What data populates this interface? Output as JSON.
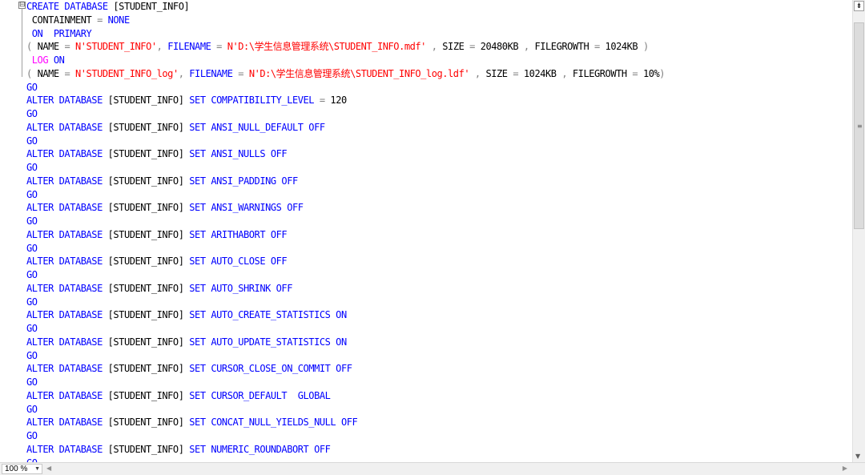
{
  "editor": {
    "lines": [
      [
        [
          "kw",
          "CREATE DATABASE"
        ],
        [
          "pl",
          " [STUDENT_INFO]"
        ]
      ],
      [
        [
          "pl",
          " CONTAINMENT"
        ],
        [
          "op",
          " = "
        ],
        [
          "kw",
          "NONE"
        ]
      ],
      [
        [
          "kw",
          " ON  PRIMARY"
        ]
      ],
      [
        [
          "op",
          "( "
        ],
        [
          "pl",
          "NAME"
        ],
        [
          "op",
          " = "
        ],
        [
          "st",
          "N'STUDENT_INFO'"
        ],
        [
          "op",
          ", "
        ],
        [
          "kw",
          "FILENAME"
        ],
        [
          "op",
          " = "
        ],
        [
          "st",
          "N'D:\\学生信息管理系统\\STUDENT_INFO.mdf'"
        ],
        [
          "op",
          " , "
        ],
        [
          "pl",
          "SIZE"
        ],
        [
          "op",
          " = "
        ],
        [
          "pl",
          "20480KB"
        ],
        [
          "op",
          " , "
        ],
        [
          "pl",
          "FILEGROWTH"
        ],
        [
          "op",
          " = "
        ],
        [
          "pl",
          "1024KB"
        ],
        [
          "op",
          " )"
        ]
      ],
      [
        [
          "lg",
          " LOG"
        ],
        [
          "kw",
          " ON"
        ]
      ],
      [
        [
          "op",
          "( "
        ],
        [
          "pl",
          "NAME"
        ],
        [
          "op",
          " = "
        ],
        [
          "st",
          "N'STUDENT_INFO_log'"
        ],
        [
          "op",
          ", "
        ],
        [
          "kw",
          "FILENAME"
        ],
        [
          "op",
          " = "
        ],
        [
          "st",
          "N'D:\\学生信息管理系统\\STUDENT_INFO_log.ldf'"
        ],
        [
          "op",
          " , "
        ],
        [
          "pl",
          "SIZE"
        ],
        [
          "op",
          " = "
        ],
        [
          "pl",
          "1024KB"
        ],
        [
          "op",
          " , "
        ],
        [
          "pl",
          "FILEGROWTH"
        ],
        [
          "op",
          " = "
        ],
        [
          "pl",
          "10%"
        ],
        [
          "op",
          ")"
        ]
      ],
      [
        [
          "kw",
          "GO"
        ]
      ],
      [
        [
          "kw",
          "ALTER DATABASE"
        ],
        [
          "pl",
          " [STUDENT_INFO] "
        ],
        [
          "kw",
          "SET COMPATIBILITY_LEVEL"
        ],
        [
          "op",
          " = "
        ],
        [
          "pl",
          "120"
        ]
      ],
      [
        [
          "kw",
          "GO"
        ]
      ],
      [
        [
          "kw",
          "ALTER DATABASE"
        ],
        [
          "pl",
          " [STUDENT_INFO] "
        ],
        [
          "kw",
          "SET ANSI_NULL_DEFAULT OFF"
        ]
      ],
      [
        [
          "kw",
          "GO"
        ]
      ],
      [
        [
          "kw",
          "ALTER DATABASE"
        ],
        [
          "pl",
          " [STUDENT_INFO] "
        ],
        [
          "kw",
          "SET ANSI_NULLS OFF"
        ]
      ],
      [
        [
          "kw",
          "GO"
        ]
      ],
      [
        [
          "kw",
          "ALTER DATABASE"
        ],
        [
          "pl",
          " [STUDENT_INFO] "
        ],
        [
          "kw",
          "SET ANSI_PADDING OFF"
        ]
      ],
      [
        [
          "kw",
          "GO"
        ]
      ],
      [
        [
          "kw",
          "ALTER DATABASE"
        ],
        [
          "pl",
          " [STUDENT_INFO] "
        ],
        [
          "kw",
          "SET ANSI_WARNINGS OFF"
        ]
      ],
      [
        [
          "kw",
          "GO"
        ]
      ],
      [
        [
          "kw",
          "ALTER DATABASE"
        ],
        [
          "pl",
          " [STUDENT_INFO] "
        ],
        [
          "kw",
          "SET ARITHABORT OFF"
        ]
      ],
      [
        [
          "kw",
          "GO"
        ]
      ],
      [
        [
          "kw",
          "ALTER DATABASE"
        ],
        [
          "pl",
          " [STUDENT_INFO] "
        ],
        [
          "kw",
          "SET AUTO_CLOSE OFF"
        ]
      ],
      [
        [
          "kw",
          "GO"
        ]
      ],
      [
        [
          "kw",
          "ALTER DATABASE"
        ],
        [
          "pl",
          " [STUDENT_INFO] "
        ],
        [
          "kw",
          "SET AUTO_SHRINK OFF"
        ]
      ],
      [
        [
          "kw",
          "GO"
        ]
      ],
      [
        [
          "kw",
          "ALTER DATABASE"
        ],
        [
          "pl",
          " [STUDENT_INFO] "
        ],
        [
          "kw",
          "SET AUTO_CREATE_STATISTICS ON"
        ]
      ],
      [
        [
          "kw",
          "GO"
        ]
      ],
      [
        [
          "kw",
          "ALTER DATABASE"
        ],
        [
          "pl",
          " [STUDENT_INFO] "
        ],
        [
          "kw",
          "SET AUTO_UPDATE_STATISTICS ON"
        ]
      ],
      [
        [
          "kw",
          "GO"
        ]
      ],
      [
        [
          "kw",
          "ALTER DATABASE"
        ],
        [
          "pl",
          " [STUDENT_INFO] "
        ],
        [
          "kw",
          "SET CURSOR_CLOSE_ON_COMMIT OFF"
        ]
      ],
      [
        [
          "kw",
          "GO"
        ]
      ],
      [
        [
          "kw",
          "ALTER DATABASE"
        ],
        [
          "pl",
          " [STUDENT_INFO] "
        ],
        [
          "kw",
          "SET CURSOR_DEFAULT  GLOBAL"
        ]
      ],
      [
        [
          "kw",
          "GO"
        ]
      ],
      [
        [
          "kw",
          "ALTER DATABASE"
        ],
        [
          "pl",
          " [STUDENT_INFO] "
        ],
        [
          "kw",
          "SET CONCAT_NULL_YIELDS_NULL OFF"
        ]
      ],
      [
        [
          "kw",
          "GO"
        ]
      ],
      [
        [
          "kw",
          "ALTER DATABASE"
        ],
        [
          "pl",
          " [STUDENT_INFO] "
        ],
        [
          "kw",
          "SET NUMERIC_ROUNDABORT OFF"
        ]
      ],
      [
        [
          "kw",
          "GO"
        ]
      ]
    ],
    "fold_glyph": "⊟",
    "colors": {
      "keyword": "#0000ff",
      "string": "#ff0000",
      "operator": "#808080",
      "log_keyword": "#ff00ff",
      "plain": "#000000"
    }
  },
  "statusbar": {
    "zoom_value": "100 %",
    "zoom_caret_icon": "chevron-down-icon",
    "scroll_left_icon": "scroll-left-icon",
    "scroll_right_icon": "scroll-right-icon"
  },
  "vscroll": {
    "split_icon": "split-icon",
    "grip_icon": "grip-icon",
    "down_icon": "scroll-down-icon"
  }
}
